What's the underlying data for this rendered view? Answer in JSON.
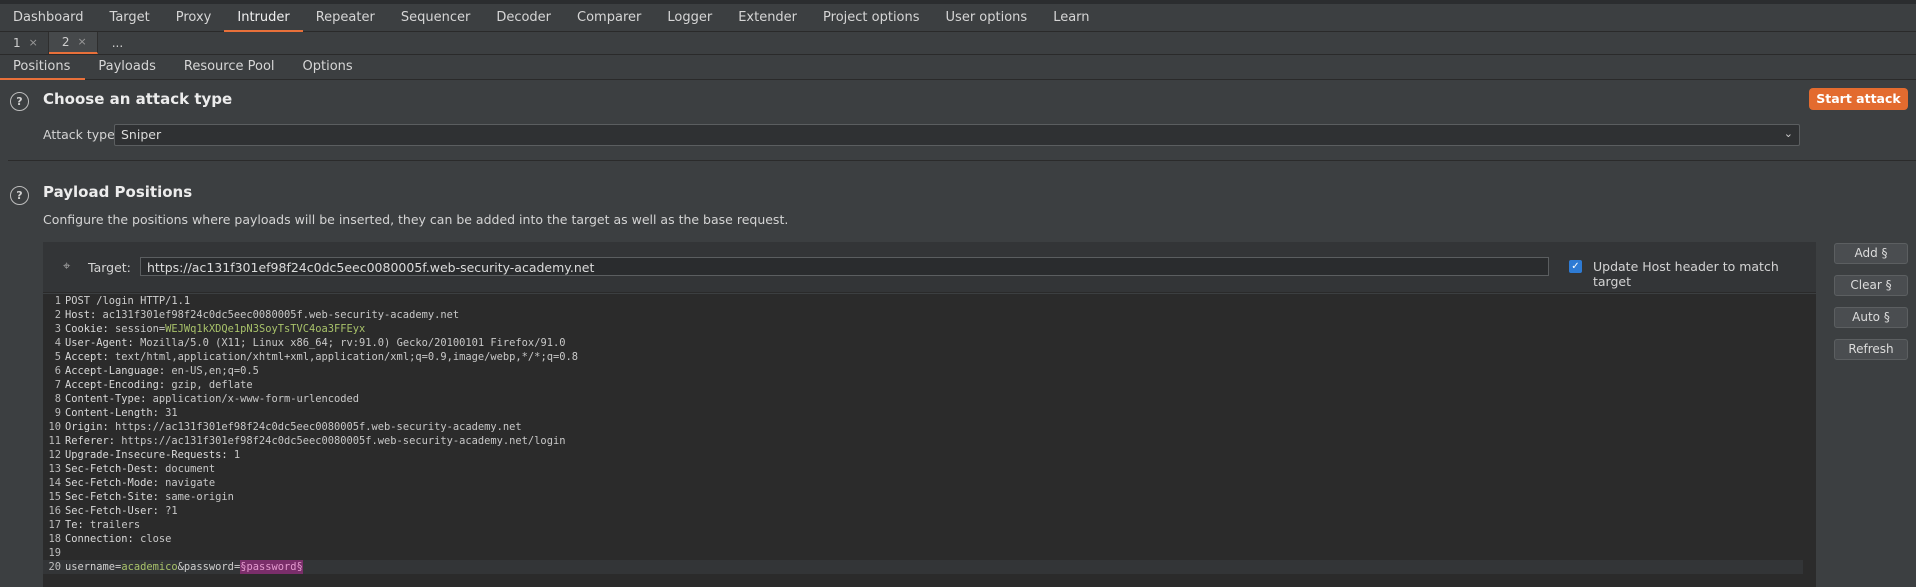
{
  "main_tabs": [
    "Dashboard",
    "Target",
    "Proxy",
    "Intruder",
    "Repeater",
    "Sequencer",
    "Decoder",
    "Comparer",
    "Logger",
    "Extender",
    "Project options",
    "User options",
    "Learn"
  ],
  "instance_tabs": [
    {
      "label": "1",
      "close": "×"
    },
    {
      "label": "2",
      "close": "×"
    }
  ],
  "instance_more": "...",
  "sub_tabs": [
    "Positions",
    "Payloads",
    "Resource Pool",
    "Options"
  ],
  "attack": {
    "help_icon": "?",
    "title": "Choose an attack type",
    "start_button": "Start attack",
    "type_label": "Attack type:",
    "type_value": "Sniper",
    "chevron": "⌄"
  },
  "positions": {
    "help_icon": "?",
    "title": "Payload Positions",
    "description": "Configure the positions where payloads will be inserted, they can be added into the target as well as the base request.",
    "target_label": "Target:",
    "target_value": "https://ac131f301ef98f24c0dc5eec0080005f.web-security-academy.net",
    "update_host_checked": true,
    "update_host_label": "Update Host header to match target",
    "buttons": {
      "add": "Add §",
      "clear": "Clear §",
      "auto": "Auto §",
      "refresh": "Refresh"
    }
  },
  "request": {
    "line1": "POST /login HTTP/1.1",
    "headers": [
      {
        "n": "2",
        "name": "Host:",
        "value": " ac131f301ef98f24c0dc5eec0080005f.web-security-academy.net"
      },
      {
        "n": "3",
        "name": "Cookie:",
        "value": " session=",
        "extra": "WEJWq1kXDQe1pN3SoyTsTVC4oa3FFEyx"
      },
      {
        "n": "4",
        "name": "User-Agent:",
        "value": " Mozilla/5.0 (X11; Linux x86_64; rv:91.0) Gecko/20100101 Firefox/91.0"
      },
      {
        "n": "5",
        "name": "Accept:",
        "value": " text/html,application/xhtml+xml,application/xml;q=0.9,image/webp,*/*;q=0.8"
      },
      {
        "n": "6",
        "name": "Accept-Language:",
        "value": " en-US,en;q=0.5"
      },
      {
        "n": "7",
        "name": "Accept-Encoding:",
        "value": " gzip, deflate"
      },
      {
        "n": "8",
        "name": "Content-Type:",
        "value": " application/x-www-form-urlencoded"
      },
      {
        "n": "9",
        "name": "Content-Length:",
        "value": " 31"
      },
      {
        "n": "10",
        "name": "Origin:",
        "value": " https://ac131f301ef98f24c0dc5eec0080005f.web-security-academy.net"
      },
      {
        "n": "11",
        "name": "Referer:",
        "value": " https://ac131f301ef98f24c0dc5eec0080005f.web-security-academy.net/login"
      },
      {
        "n": "12",
        "name": "Upgrade-Insecure-Requests:",
        "value": " 1"
      },
      {
        "n": "13",
        "name": "Sec-Fetch-Dest:",
        "value": " document"
      },
      {
        "n": "14",
        "name": "Sec-Fetch-Mode:",
        "value": " navigate"
      },
      {
        "n": "15",
        "name": "Sec-Fetch-Site:",
        "value": " same-origin"
      },
      {
        "n": "16",
        "name": "Sec-Fetch-User:",
        "value": " ?1"
      },
      {
        "n": "17",
        "name": "Te:",
        "value": " trailers"
      },
      {
        "n": "18",
        "name": "Connection:",
        "value": " close"
      }
    ],
    "body": {
      "p1": "username",
      "eq1": "=",
      "v1": "academico",
      "amp": "&",
      "p2": "password",
      "eq2": "=",
      "v2": "§password§"
    }
  },
  "colors": {
    "accent": "#e36b2f",
    "checkbox": "#2e7bd4",
    "payload_marker": "#7a2e6a",
    "param_value": "#a8c26a"
  }
}
